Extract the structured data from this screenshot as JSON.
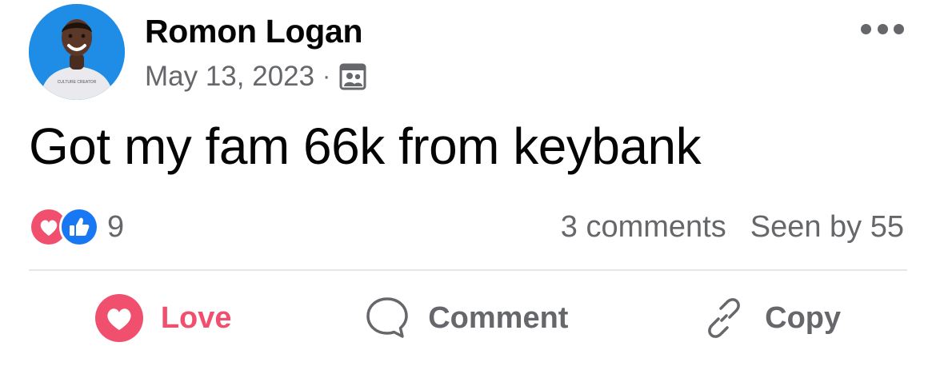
{
  "post": {
    "author": "Romon Logan",
    "date": "May 13, 2023",
    "separator": "·",
    "privacy_icon": "friends-audience-icon",
    "avatar_shirt_text": "CULTURE CREATOR",
    "text": "Got my fam 66k from keybank"
  },
  "reactions": {
    "types": [
      "love",
      "like"
    ],
    "count": "9"
  },
  "stats": {
    "comments": "3 comments",
    "seen_by": "Seen by 55"
  },
  "actions": {
    "love_label": "Love",
    "comment_label": "Comment",
    "copy_label": "Copy"
  },
  "colors": {
    "love": "#f0506e",
    "like": "#1877f2",
    "secondary_text": "#65676b",
    "avatar_bg": "#1f8de6"
  }
}
